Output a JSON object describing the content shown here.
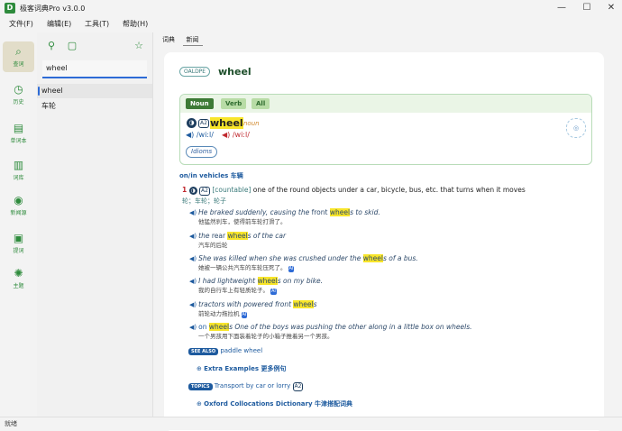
{
  "app": {
    "title": "极客词典Pro v3.0.0",
    "icon_letter": "D",
    "accent": "#2e8b3c"
  },
  "menu": [
    "文件(F)",
    "编辑(E)",
    "工具(T)",
    "帮助(H)"
  ],
  "rail": [
    {
      "label": "查词",
      "icon": "search-icon"
    },
    {
      "label": "历史",
      "icon": "history-icon"
    },
    {
      "label": "单词本",
      "icon": "notebook-icon"
    },
    {
      "label": "词库",
      "icon": "book-icon"
    },
    {
      "label": "新闻源",
      "icon": "rss-icon"
    },
    {
      "label": "提词",
      "icon": "chat-icon"
    },
    {
      "label": "主题",
      "icon": "palette-icon"
    }
  ],
  "search": {
    "value": "wheel"
  },
  "history": [
    "wheel",
    "车轮"
  ],
  "tabs": [
    "词典",
    "新闻"
  ],
  "entry": {
    "dict_badge": "OALDPE",
    "headword": "wheel",
    "pos_tabs": [
      "Noun",
      "Verb",
      "All"
    ],
    "level": "A2",
    "hw": "wheel",
    "pos": "noun",
    "pron_uk": "/wiːl/",
    "pron_us": "/wiːl/",
    "idioms": "Idioms",
    "sense_head": "on/in vehicles 车辆",
    "sense_num": "1",
    "sense_level": "A2",
    "grammar": "[countable]",
    "definition": "one of the round objects under a car, bicycle, bus, etc. that turns when it moves",
    "definition_zh": "轮；车轮；轮子",
    "examples": [
      {
        "pre": "He braked suddenly, causing the ",
        "mid": "front ",
        "hl": "wheel",
        "post": "s to skid.",
        "zh": "他猛然刹车，使得前车轮打滑了。",
        "ai": ""
      },
      {
        "pre": "the ",
        "mid": "rear ",
        "hl": "wheel",
        "post": "s of the car",
        "zh": "汽车的后轮",
        "ai": ""
      },
      {
        "pre": "She was killed when she was crushed under the ",
        "mid": "",
        "hl": "wheel",
        "post": "s of a bus.",
        "zh": "她被一辆公共汽车的车轮压死了。",
        "ai": "AI"
      },
      {
        "pre": "I had lightweight ",
        "mid": "",
        "hl": "wheel",
        "post": "s on my bike.",
        "zh": "我的自行车上有轻质轮子。",
        "ai": "AI"
      },
      {
        "pre": "tractors with powered front ",
        "mid": "",
        "hl": "wheel",
        "post": "s",
        "zh": "前轮动力拖拉机",
        "ai": "AI"
      },
      {
        "pre": "on ",
        "mid": "",
        "hl": "wheel",
        "post": "s One of the boys was pushing the other along in a little box on wheels.",
        "zh": "一个男孩用下面装着轮子的小箱子推着另一个男孩。",
        "ai": ""
      }
    ],
    "see_also_tag": "SEE ALSO",
    "see_also": "paddle wheel",
    "extra_examples": "Extra Examples 更多例句",
    "topics_tag": "TOPICS",
    "topics": "Transport by car or lorry",
    "topics_level": "A2",
    "collocations": "Oxford Collocations Dictionary 牛津搭配词典"
  },
  "status": "就绪"
}
